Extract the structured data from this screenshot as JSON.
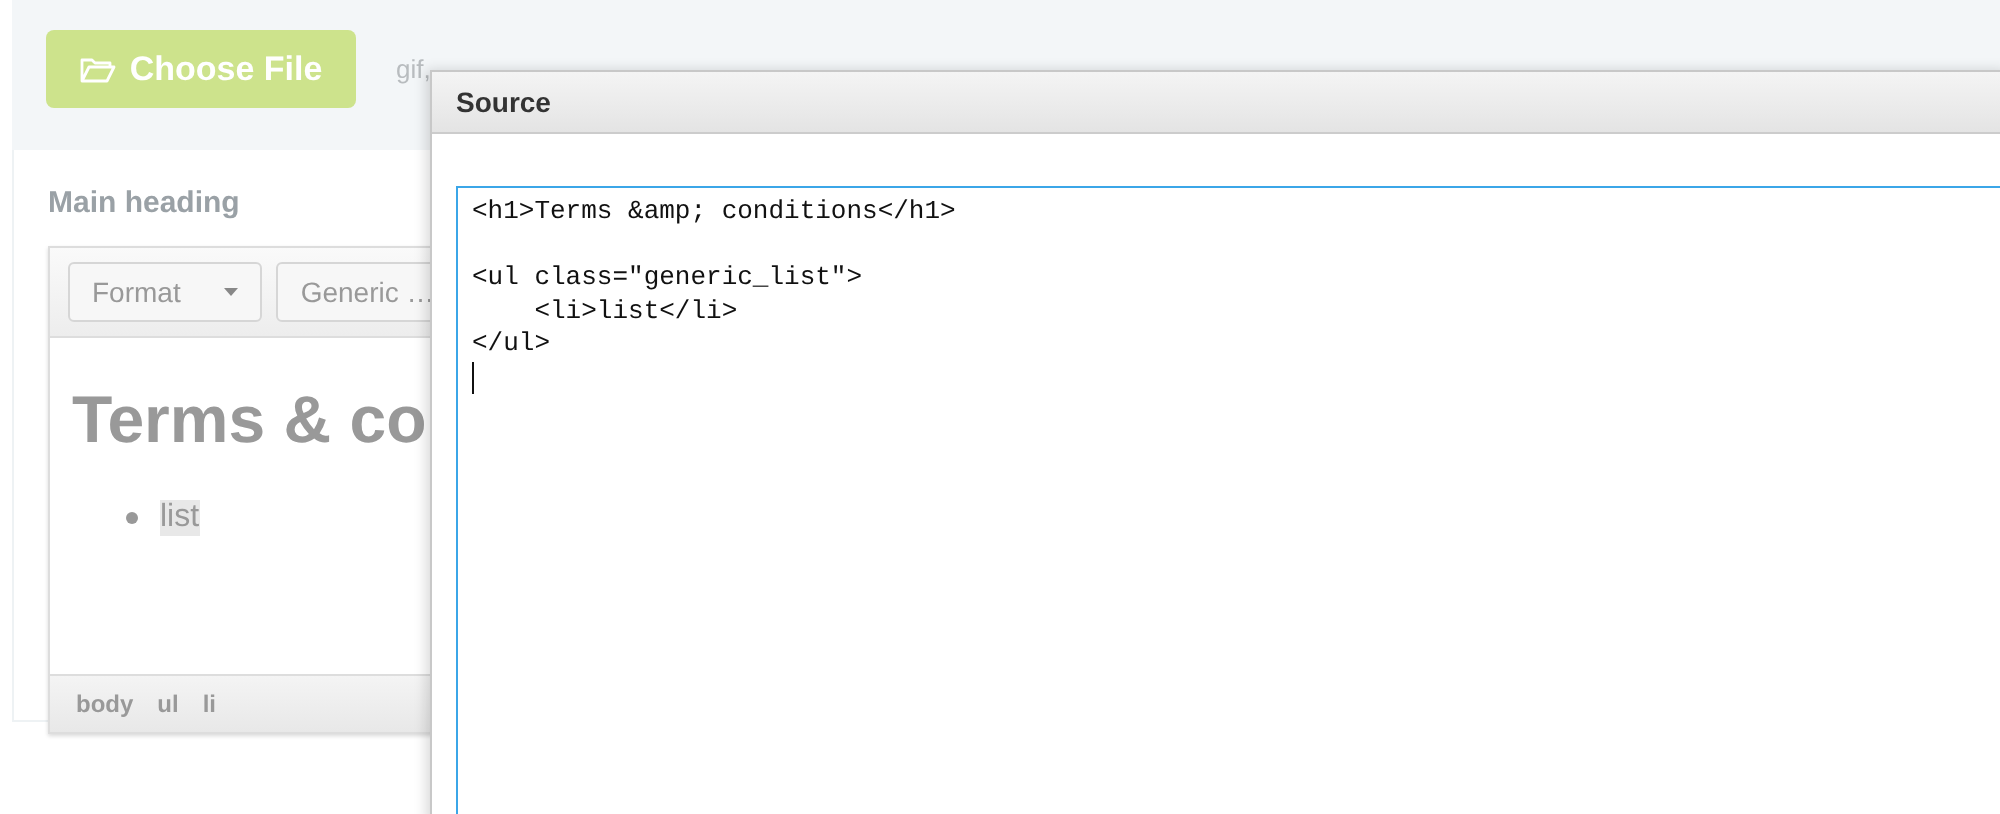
{
  "upload": {
    "button": "Choose File",
    "formats": "gif,"
  },
  "field": {
    "label": "Main heading"
  },
  "editor": {
    "toolbar": [
      {
        "label": "Format",
        "kind": "dropdown"
      },
      {
        "label": "Generic …",
        "kind": "plain"
      }
    ],
    "heading": "Terms & co",
    "list": [
      "list"
    ],
    "path": [
      "body",
      "ul",
      "li"
    ]
  },
  "dialog": {
    "title": "Source",
    "code": "<h1>Terms &amp; conditions</h1>\n\n<ul class=\"generic_list\">\n    <li>list</li>\n</ul>"
  }
}
